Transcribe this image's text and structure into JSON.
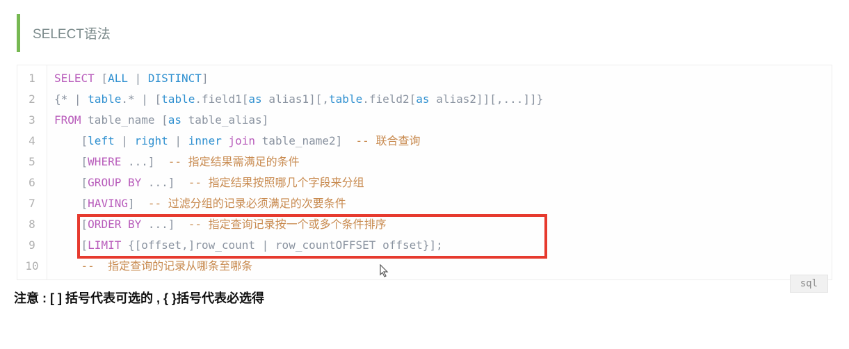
{
  "heading": "SELECT语法",
  "code": {
    "line_numbers": [
      "1",
      "2",
      "3",
      "4",
      "5",
      "6",
      "7",
      "8",
      "9",
      "10"
    ],
    "t": {
      "SELECT": "SELECT",
      "ALL": "ALL",
      "DISTINCT": "DISTINCT",
      "FROM": "FROM",
      "left": "left",
      "right": "right",
      "inner": "inner",
      "join": "join",
      "WHERE": "WHERE",
      "GROUP": "GROUP",
      "BY": "BY",
      "HAVING": "HAVING",
      "ORDER": "ORDER",
      "LIMIT": "LIMIT",
      "as": "as",
      "OFFSET": "OFFSET",
      "table": "table",
      "table_name": "table_name",
      "table_name2": "table_name2",
      "table_alias": "table_alias",
      "field1": "field1",
      "field2": "field2",
      "alias1": "alias1",
      "alias2": "alias2",
      "row_count": "row_count",
      "offset": "offset",
      "star": "*",
      "cmt4": "-- 联合查询",
      "cmt5": "-- 指定结果需满足的条件",
      "cmt6": "-- 指定结果按照哪几个字段来分组",
      "cmt7": "-- 过滤分组的记录必须满足的次要条件",
      "cmt8": "-- 指定查询记录按一个或多个条件排序",
      "cmt10": "--  指定查询的记录从哪条至哪条"
    }
  },
  "annotation": {
    "highlight_lines": [
      8,
      9
    ]
  },
  "footer_note": "注意 : [ ] 括号代表可选的 , { }括号代表必选得",
  "lang_badge": "sql"
}
